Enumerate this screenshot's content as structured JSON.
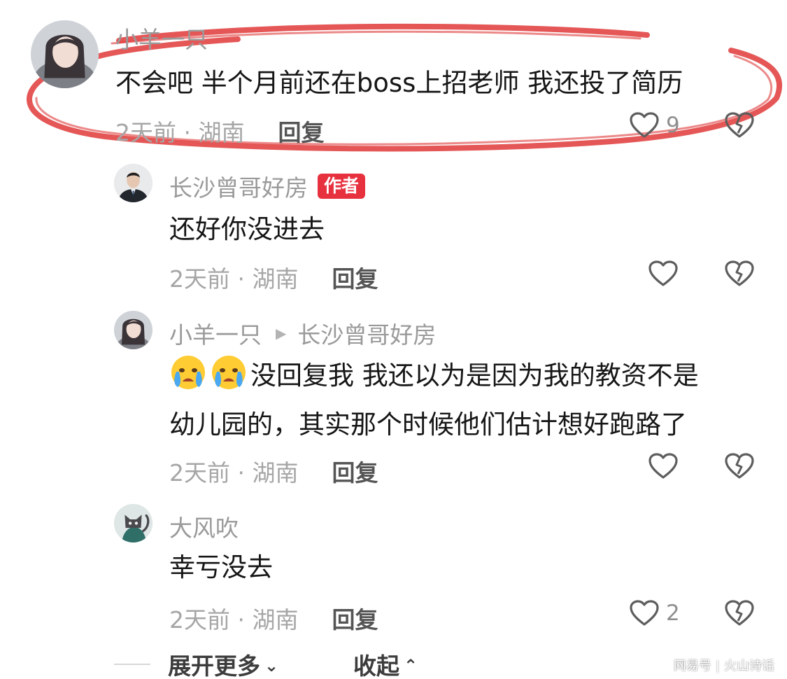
{
  "comments": [
    {
      "name": "小羊一只",
      "text": "不会吧 半个月前还在boss上招老师 我还投了简历",
      "time_location": "2天前 · 湖南",
      "reply": "回复",
      "likes": "9"
    },
    {
      "name": "长沙曾哥好房",
      "badge": "作者",
      "text": "还好你没进去",
      "time_location": "2天前 · 湖南",
      "reply": "回复"
    },
    {
      "name": "小羊一只",
      "reply_to": "长沙曾哥好房",
      "text_line1": "没回复我 我还以为是因为我的教资不是",
      "text_line2": "幼儿园的，其实那个时候他们估计想好跑路了",
      "time_location": "2天前 · 湖南",
      "reply": "回复"
    },
    {
      "name": "大风吹",
      "text": "幸亏没去",
      "time_location": "2天前 · 湖南",
      "reply": "回复",
      "likes": "2"
    }
  ],
  "footer": {
    "expand_label": "展开更多",
    "collapse_label": "收起"
  },
  "watermark": {
    "left": "网易号",
    "right": "火山诗话"
  },
  "colors": {
    "author_badge": "#e8313f",
    "highlight_scribble": "#e03a3a"
  }
}
